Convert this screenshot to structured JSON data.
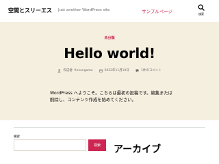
{
  "header": {
    "site_title": "空間とスリーエス",
    "site_description": "Just another WordPress site",
    "nav_link": "サンプルページ",
    "search_toggle_label": "検索",
    "search_icon": "search-icon"
  },
  "post": {
    "category": "未分類",
    "title": "Hello world!",
    "meta": {
      "author": "作成者: fineengame",
      "date": "2022年11月10日",
      "comments": "1件のコメント"
    },
    "excerpt": "WordPress へようこそ。こちらは最初の投稿です。編集または削除し、コンテンツ作成を始めてください。"
  },
  "widgets": {
    "search_label": "検索",
    "search_value": "",
    "search_button": "検索",
    "archive_heading": "アーカイブ"
  },
  "colors": {
    "accent": "#cd2653",
    "background": "#f5efe0",
    "header_bg": "#ffffff"
  }
}
